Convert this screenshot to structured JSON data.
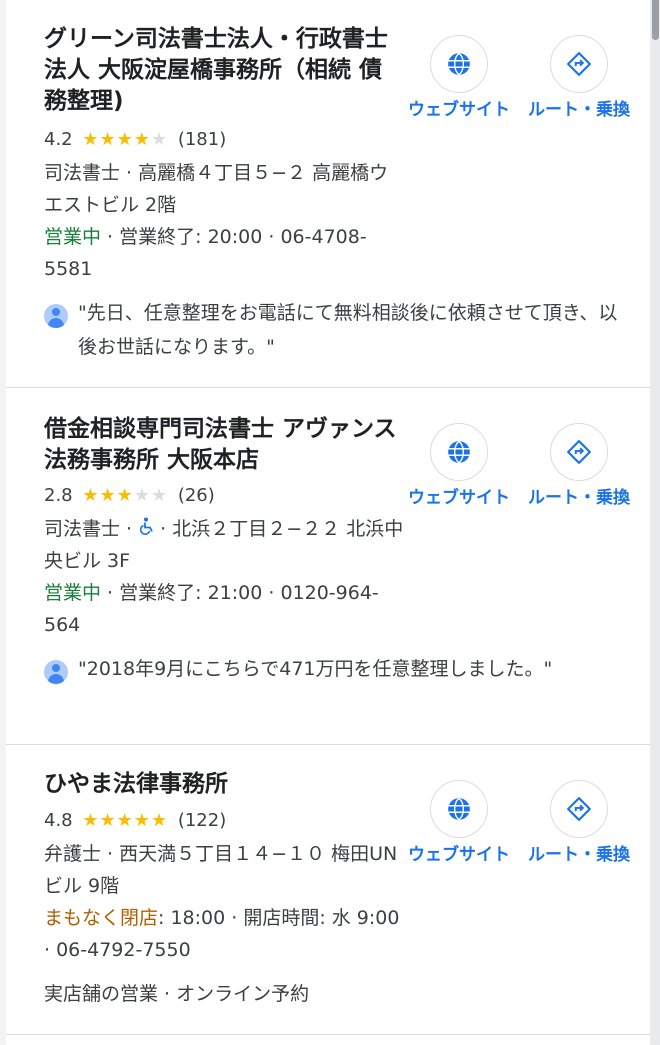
{
  "colors": {
    "accent": "#1a73e8",
    "open": "#188038",
    "closing_soon": "#b06000",
    "star": "#fbbc04"
  },
  "listings": [
    {
      "title": "グリーン司法書士法人・行政書士法人 大阪淀屋橋事務所（相続 債務整理)",
      "rating": "4.2",
      "stars_filled": 4,
      "review_count": "(181)",
      "category_address": "司法書士 · 高麗橋４丁目５−２ 高麗橋ウエストビル 2階",
      "hours_status": "営業中",
      "hours_detail": " · 営業終了: 20:00 · 06-4708-5581",
      "review": "\"先日、任意整理をお電話にて無料相談後に依頼させて頂き、以後お世話になります。\"",
      "website_label": "ウェブサイト",
      "route_label": "ルート・乗換"
    },
    {
      "title": "借金相談専門司法書士 アヴァンス法務事務所 大阪本店",
      "rating": "2.8",
      "stars_filled": 3,
      "review_count": "(26)",
      "category": "司法書士 · ",
      "accessibility_icon": "wheelchair-icon",
      "address": " · 北浜２丁目２−２２ 北浜中央ビル 3F",
      "hours_status": "営業中",
      "hours_detail": " · 営業終了: 21:00 · 0120-964-564",
      "review": "\"2018年9月にこちらで471万円を任意整理しました。\"",
      "website_label": "ウェブサイト",
      "route_label": "ルート・乗換"
    },
    {
      "title": "ひやま法律事務所",
      "rating": "4.8",
      "stars_filled": 5,
      "review_count": "(122)",
      "category_address": "弁護士 · 西天満５丁目１４−１０ 梅田UNビル 9階",
      "hours_status": "まもなく閉店",
      "hours_detail": ": 18:00 · 開店時間: 水 9:00 · 06-4792-7550",
      "features": "実店舗の営業 · オンライン予約",
      "website_label": "ウェブサイト",
      "route_label": "ルート・乗換"
    }
  ]
}
